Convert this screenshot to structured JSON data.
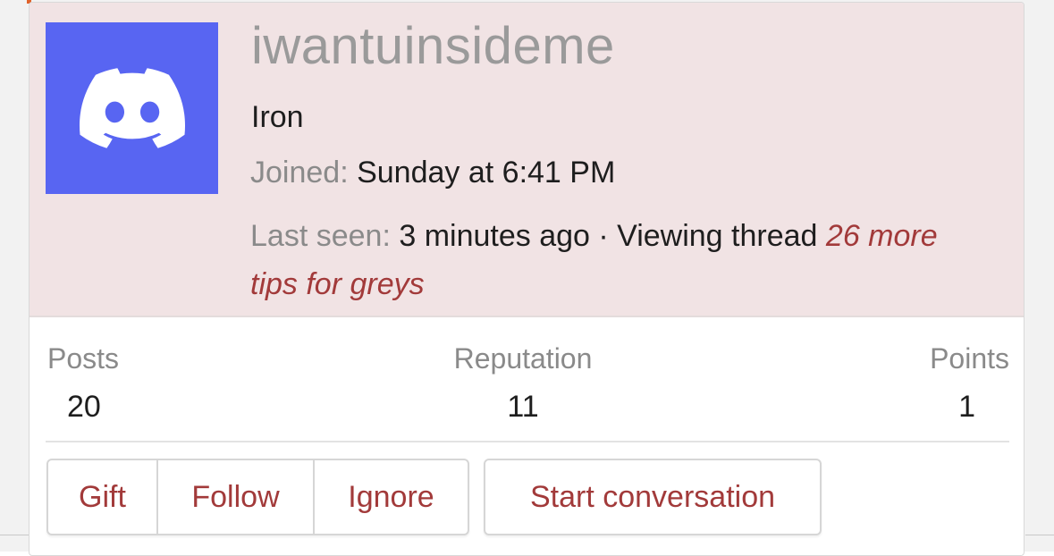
{
  "profile": {
    "username": "iwantuinsideme",
    "user_title": "Iron",
    "joined_label": "Joined:",
    "joined_value": "Sunday at 6:41 PM",
    "last_seen_label": "Last seen:",
    "last_seen_value": "3 minutes ago · Viewing thread",
    "viewing_thread": "26 more tips for greys",
    "avatar_icon": "discord-logo-icon",
    "avatar_color": "#5865f2",
    "header_bg": "#f1e3e4",
    "link_color": "#a23a3a"
  },
  "stats": {
    "posts_label": "Posts",
    "posts_value": "20",
    "reputation_label": "Reputation",
    "reputation_value": "11",
    "points_label": "Points",
    "points_value": "1"
  },
  "actions": {
    "gift_label": "Gift",
    "follow_label": "Follow",
    "ignore_label": "Ignore",
    "conversation_label": "Start conversation"
  }
}
